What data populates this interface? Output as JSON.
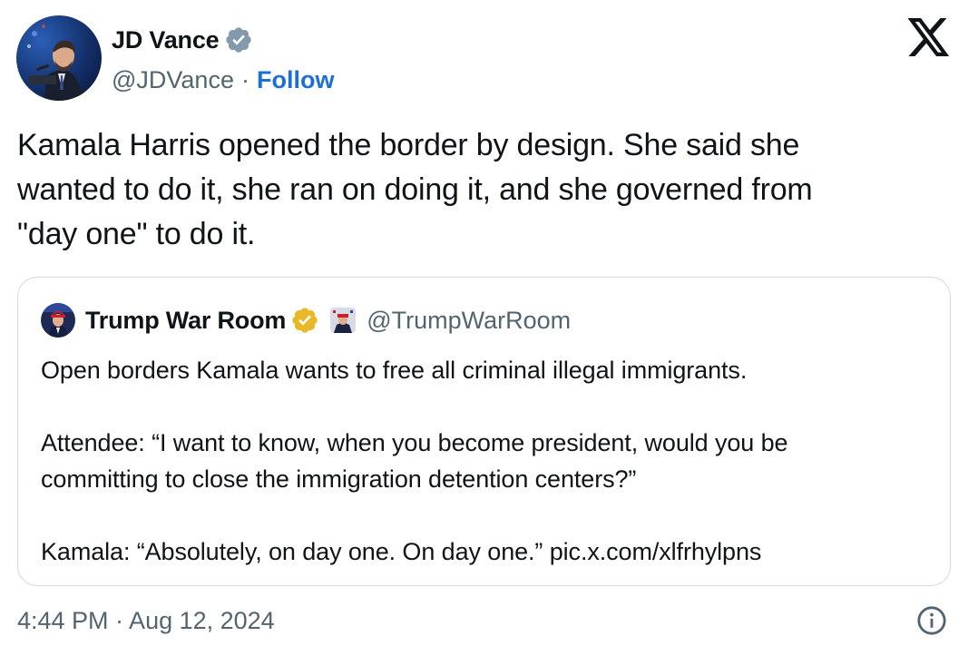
{
  "author": {
    "name": "JD Vance",
    "handle": "@JDVance",
    "separator": "·",
    "follow_label": "Follow",
    "badge_color": "#829aab"
  },
  "tweet": {
    "text": "Kamala Harris opened the border by design. She said she\nwanted to do it, she ran on doing it, and she governed from\n\"day one\" to do it."
  },
  "quote": {
    "name": "Trump War Room",
    "handle": "@TrumpWarRoom",
    "badge_color": "#e8b829",
    "text": "Open borders Kamala wants to free all criminal illegal immigrants.\n\nAttendee: “I want to know, when you become president, would you be\ncommitting to close the immigration detention centers?”\n\nKamala: “Absolutely, on day one. On day one.” pic.x.com/xlfrhylpns"
  },
  "footer": {
    "timestamp": "4:44 PM · Aug 12, 2024"
  },
  "icons": {
    "brand": "x-logo-icon",
    "info": "info-icon",
    "verified": "verified-badge-icon"
  },
  "colors": {
    "link": "#1d6fd8",
    "secondary_text": "#536471",
    "border": "#cfd9de"
  }
}
